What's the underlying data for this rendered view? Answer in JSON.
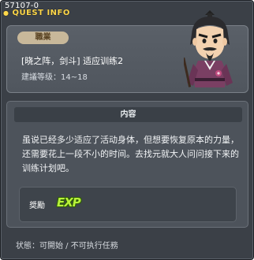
{
  "window": {
    "quest_id": "57107-0",
    "title": "QUEST INFO"
  },
  "quest": {
    "job_badge": "職業",
    "name": "[晓之阵，剑斗] 适应训练2",
    "level_label": "建議等级：14~18"
  },
  "content": {
    "header": "内容",
    "text": "虽说已经多少适应了活动身体，但想要恢复原本的力量，还需要花上一段不小的时间。去找元就大人问问接下来的训练计划吧。"
  },
  "reward": {
    "label": "奨勵",
    "exp_icon_text": "EXP"
  },
  "status": {
    "text": "状態：可開始 / 不可执行任務"
  },
  "colors": {
    "title": "#ffd84a",
    "background": "#3b4047",
    "badge": "#c8b89a",
    "exp": "#b8f23a"
  },
  "icons": {
    "title_dot": "yellow-dot-icon",
    "npc": "samurai-npc-portrait",
    "exp": "exp-icon"
  }
}
